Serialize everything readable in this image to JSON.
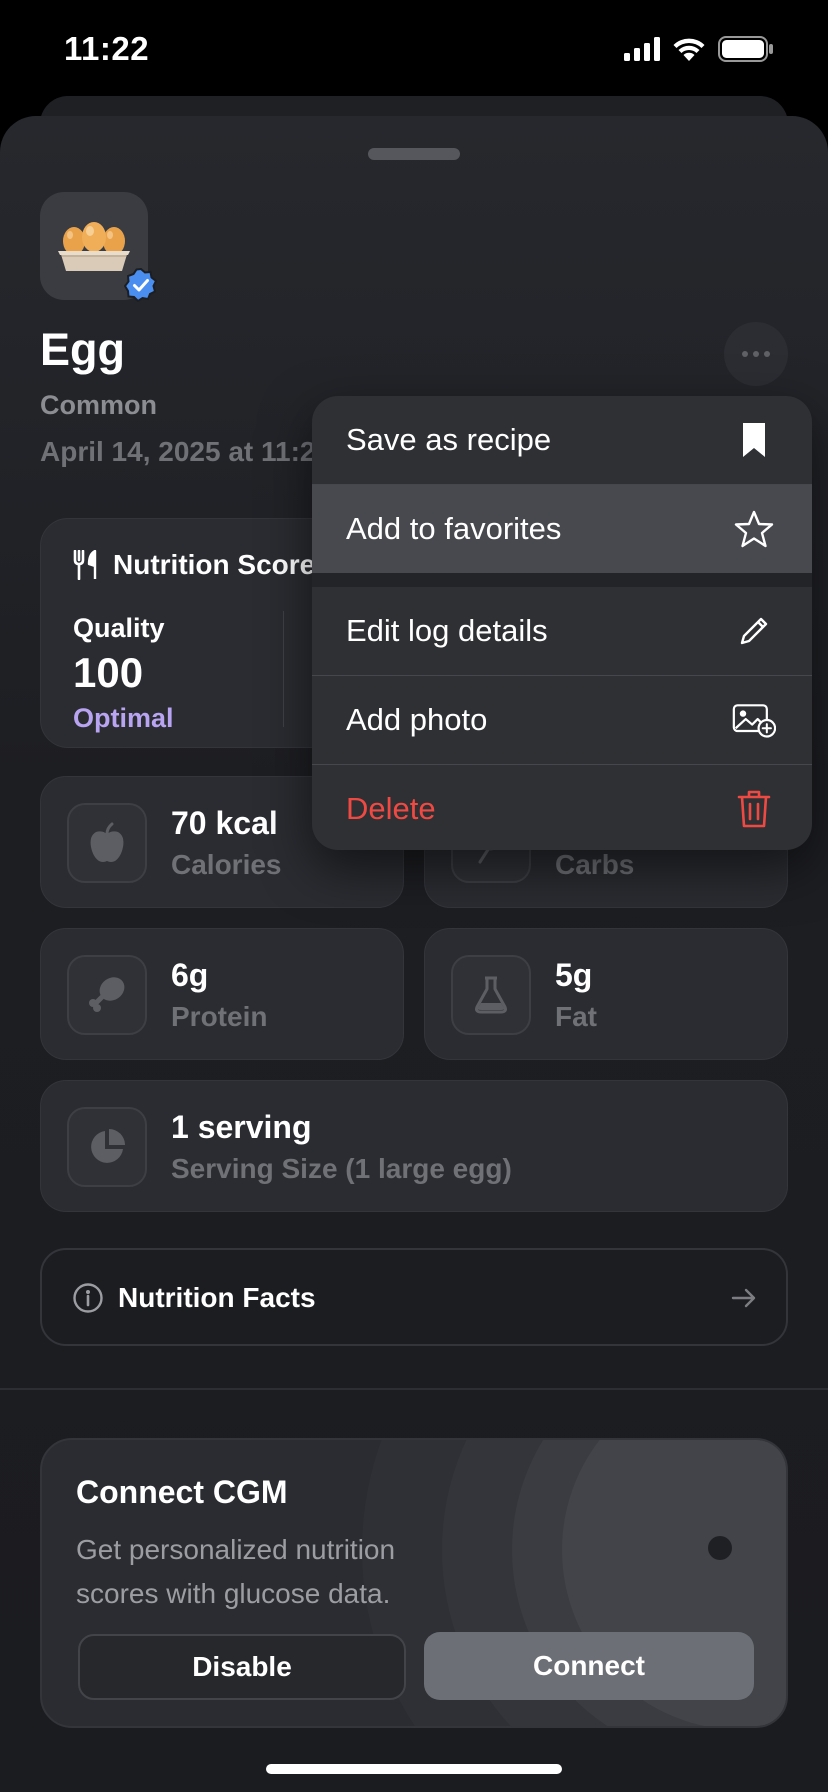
{
  "status_bar": {
    "time": "11:22"
  },
  "food": {
    "name": "Egg",
    "category": "Common",
    "date": "April 14, 2025 at 11:22"
  },
  "nutrition_score": {
    "title": "Nutrition Score",
    "quality_label": "Quality",
    "quality_value": "100",
    "quality_status": "Optimal"
  },
  "stats": {
    "calories": {
      "value": "70 kcal",
      "label": "Calories"
    },
    "carbs": {
      "label": "Carbs"
    },
    "protein": {
      "value": "6g",
      "label": "Protein"
    },
    "fat": {
      "value": "5g",
      "label": "Fat"
    },
    "serving": {
      "value": "1 serving",
      "label": "Serving Size (1 large egg)"
    }
  },
  "nutrition_facts": {
    "label": "Nutrition Facts"
  },
  "cgm": {
    "title": "Connect CGM",
    "description": "Get personalized nutrition scores with glucose data.",
    "disable_label": "Disable",
    "connect_label": "Connect"
  },
  "menu": {
    "items": [
      {
        "label": "Save as recipe",
        "icon": "bookmark-icon"
      },
      {
        "label": "Add to favorites",
        "icon": "star-icon"
      },
      {
        "label": "Edit log details",
        "icon": "pencil-icon"
      },
      {
        "label": "Add photo",
        "icon": "add-photo-icon"
      },
      {
        "label": "Delete",
        "icon": "trash-icon"
      }
    ]
  },
  "colors": {
    "accent_purple": "#b9a4f2",
    "danger_red": "#ee4a43",
    "verified_blue": "#4a8ff0"
  }
}
